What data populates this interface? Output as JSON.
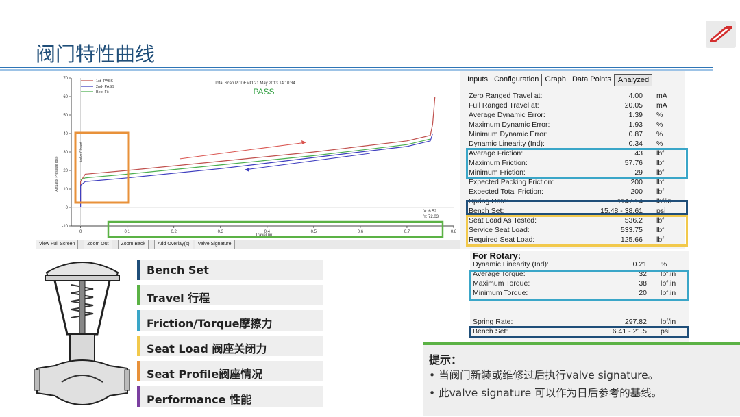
{
  "slide": {
    "title": "阀门特性曲线"
  },
  "toolbar": {
    "buttons": [
      "View Full Screen",
      "Zoom Out",
      "Zoom Back",
      "Add Overlay(s)",
      "Valve Signature"
    ]
  },
  "tabs": [
    {
      "label": "Inputs",
      "active": false
    },
    {
      "label": "Configuration",
      "active": false
    },
    {
      "label": "Graph",
      "active": false
    },
    {
      "label": "Data Points",
      "active": false
    },
    {
      "label": "Analyzed",
      "active": true
    }
  ],
  "analysis": {
    "rows": [
      {
        "label": "Zero Ranged Travel at:",
        "value": "4.00",
        "unit": "mA"
      },
      {
        "label": "Full Ranged Travel at:",
        "value": "20.05",
        "unit": "mA"
      },
      {
        "label": "Average Dynamic Error:",
        "value": "1.39",
        "unit": "%"
      },
      {
        "label": "Maximum Dynamic Error:",
        "value": "1.93",
        "unit": "%"
      },
      {
        "label": "Minimum Dynamic Error:",
        "value": "0.87",
        "unit": "%"
      },
      {
        "label": "Dynamic Linearity (Ind):",
        "value": "0.34",
        "unit": "%"
      },
      {
        "label": "Average Friction:",
        "value": "43",
        "unit": "lbf"
      },
      {
        "label": "Maximum Friction:",
        "value": "57.76",
        "unit": "lbf"
      },
      {
        "label": "Minimum Friction:",
        "value": "29",
        "unit": "lbf"
      },
      {
        "label": "Expected Packing Friction:",
        "value": "200",
        "unit": "lbf"
      },
      {
        "label": "Expected Total Friction:",
        "value": "200",
        "unit": "lbf"
      },
      {
        "label": "Spring Rate:",
        "value": "1147.14",
        "unit": "lbf/in"
      },
      {
        "label": "Bench Set:",
        "value": "15.48 - 38.61",
        "unit": "psi"
      },
      {
        "label": "Seat Load As Tested:",
        "value": "536.2",
        "unit": "lbf"
      },
      {
        "label": "Service Seat Load:",
        "value": "533.75",
        "unit": "lbf"
      },
      {
        "label": "Required Seat Load:",
        "value": "125.66",
        "unit": "lbf"
      }
    ]
  },
  "rotary": {
    "title": "For Rotary:",
    "rows": [
      {
        "label": "Dynamic Linearity (Ind):",
        "value": "0.21",
        "unit": "%"
      },
      {
        "label": "Average Torque:",
        "value": "32",
        "unit": "lbf.in"
      },
      {
        "label": "Maximum Torque:",
        "value": "38",
        "unit": "lbf.in"
      },
      {
        "label": "Minimum Torque:",
        "value": "20",
        "unit": "lbf.in"
      },
      {
        "label": "Spring Rate:",
        "value": "297.82",
        "unit": "lbf/in"
      },
      {
        "label": "Bench Set:",
        "value": "6.41 - 21.5",
        "unit": "psi"
      }
    ]
  },
  "chart_data": {
    "type": "line",
    "title": "Total Scan PDDEMO 21 May 2013 14:10:34",
    "status": "PASS",
    "xlabel": "Travel (in)",
    "ylabel": "Actuator Pressure (psi)",
    "xlim": [
      -0.02,
      0.8
    ],
    "ylim": [
      -10,
      70
    ],
    "xticks": [
      "0",
      "0.1",
      "0.2",
      "0.3",
      "0.4",
      "0.5",
      "0.6",
      "0.7",
      "0.8"
    ],
    "yticks": [
      "-10",
      "0",
      "10",
      "20",
      "30",
      "40",
      "50",
      "60",
      "70"
    ],
    "grid": false,
    "legend_position": "top-left",
    "annotation_left": "Valve Closed",
    "cursor_readout": {
      "x": "X: 6.52",
      "y": "Y: 72.03"
    },
    "series": [
      {
        "name": "1st- PASS",
        "color": "#c0504d",
        "x": [
          0,
          0.0,
          0.01,
          0.1,
          0.3,
          0.5,
          0.7,
          0.75,
          0.755,
          0.76
        ],
        "y": [
          2,
          14,
          18,
          20,
          25,
          30,
          36,
          39,
          45,
          60
        ]
      },
      {
        "name": "2nd- PASS",
        "color": "#3f3fbf",
        "x": [
          0,
          0.0,
          0.01,
          0.1,
          0.3,
          0.5,
          0.7,
          0.75,
          0.755
        ],
        "y": [
          0,
          12,
          14,
          16,
          21,
          27,
          33,
          36,
          40
        ]
      },
      {
        "name": "Best Fit",
        "color": "#4caf50",
        "x": [
          0,
          0.01,
          0.1,
          0.3,
          0.5,
          0.7,
          0.75
        ],
        "y": [
          15,
          16,
          18,
          23,
          28,
          34,
          37
        ]
      }
    ]
  },
  "categories": [
    {
      "label": "Bench Set",
      "color": "#1f4e79"
    },
    {
      "label": "Travel 行程",
      "color": "#5bb245"
    },
    {
      "label": "Friction/Torque摩擦力",
      "color": "#3aa6c8"
    },
    {
      "label": "Seat Load 阀座关闭力",
      "color": "#f2c94c"
    },
    {
      "label": "Seat Profile阀座情况",
      "color": "#e8913a"
    },
    {
      "label": "Performance 性能",
      "color": "#7b3fa0"
    }
  ],
  "tip": {
    "title": "提示：",
    "lines": [
      "• 当阀门新装或维修过后执行valve signature。",
      "• 此valve signature 可以作为日后参考的基线。"
    ]
  },
  "colors": {
    "bench_box": "#1f4e79",
    "travel_box": "#5bb245",
    "friction_box": "#3aa6c8",
    "seat_box": "#f2c94c",
    "profile_box": "#e8913a",
    "pass_text": "#2e9e3e"
  }
}
